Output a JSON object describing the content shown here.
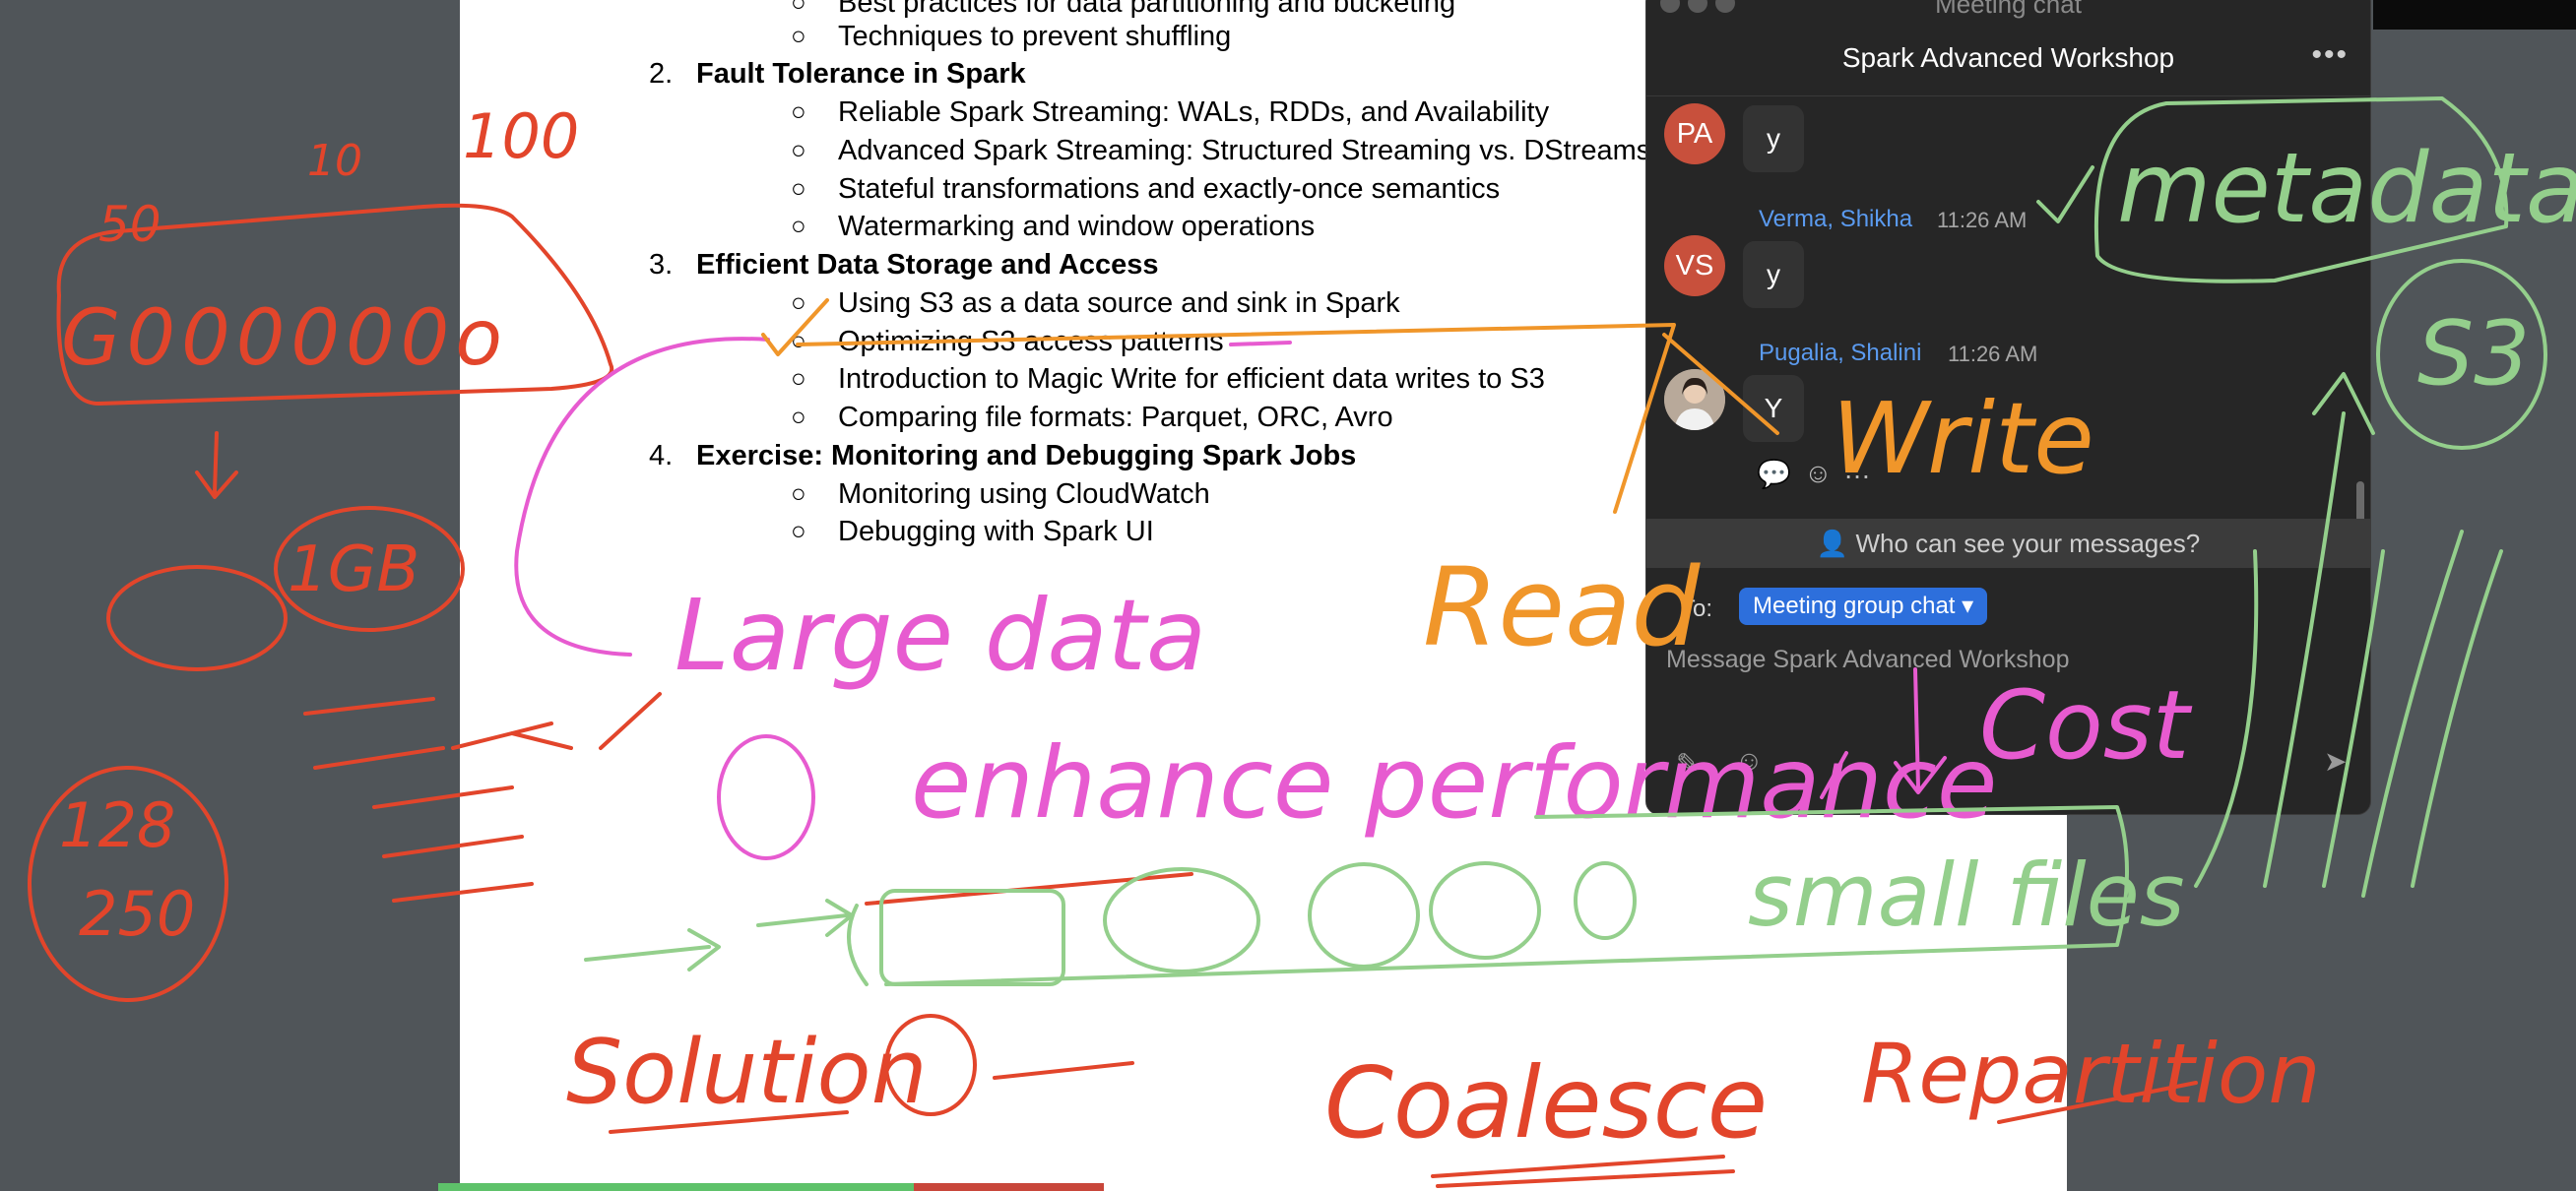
{
  "document": {
    "partial_top_lines": [
      "Best practices for data partitioning and bucketing",
      "Techniques to prevent shuffling"
    ],
    "sections": [
      {
        "number": "2.",
        "title": "Fault Tolerance in Spark",
        "items": [
          "Reliable Spark Streaming: WALs, RDDs, and Availability",
          "Advanced Spark Streaming: Structured Streaming vs. DStreams",
          "Stateful transformations and exactly-once semantics",
          "Watermarking and window operations"
        ]
      },
      {
        "number": "3.",
        "title": "Efficient Data Storage and Access",
        "items": [
          "Using S3 as a data source and sink in Spark",
          "Optimizing S3 access patterns",
          "Introduction to Magic Write for efficient data writes to S3",
          "Comparing file formats: Parquet, ORC, Avro"
        ]
      },
      {
        "number": "4.",
        "title": "Exercise: Monitoring and Debugging Spark Jobs",
        "items": [
          "Monitoring using CloudWatch",
          "Debugging with Spark UI"
        ]
      }
    ],
    "bullet_char": "○"
  },
  "chat": {
    "window_title": "Meeting chat",
    "title": "Spark Advanced Workshop",
    "more_icon": "•••",
    "messages": [
      {
        "initials": "PA",
        "sender": "",
        "time": "",
        "text": "y"
      },
      {
        "initials": "VS",
        "sender": "Verma, Shikha",
        "time": "11:26 AM",
        "text": "y"
      },
      {
        "initials": "",
        "sender": "Pugalia, Shalini",
        "time": "11:26 AM",
        "text": "Y"
      }
    ],
    "visibility_notice": "Who can see your messages?",
    "to_label": "To:",
    "recipient": "Meeting group chat",
    "message_placeholder": "Message Spark Advanced Workshop"
  },
  "annotations": {
    "labels": [
      "100",
      "10",
      "50",
      "G000000o",
      "1GB",
      "128",
      "250",
      "metadata",
      "S3",
      "Write",
      "Read",
      "Large data",
      "enhance performance",
      "Cost",
      "small files",
      "Solution",
      "Coalesce",
      "Repartition"
    ]
  },
  "colors": {
    "ink_red": "#e2452b",
    "ink_pink": "#e75bd0",
    "ink_orange": "#f0962a",
    "ink_green": "#94cf8c",
    "chat_bg": "#262626",
    "accent_blue": "#2d6fdc",
    "sender_blue": "#5b9bf0"
  }
}
